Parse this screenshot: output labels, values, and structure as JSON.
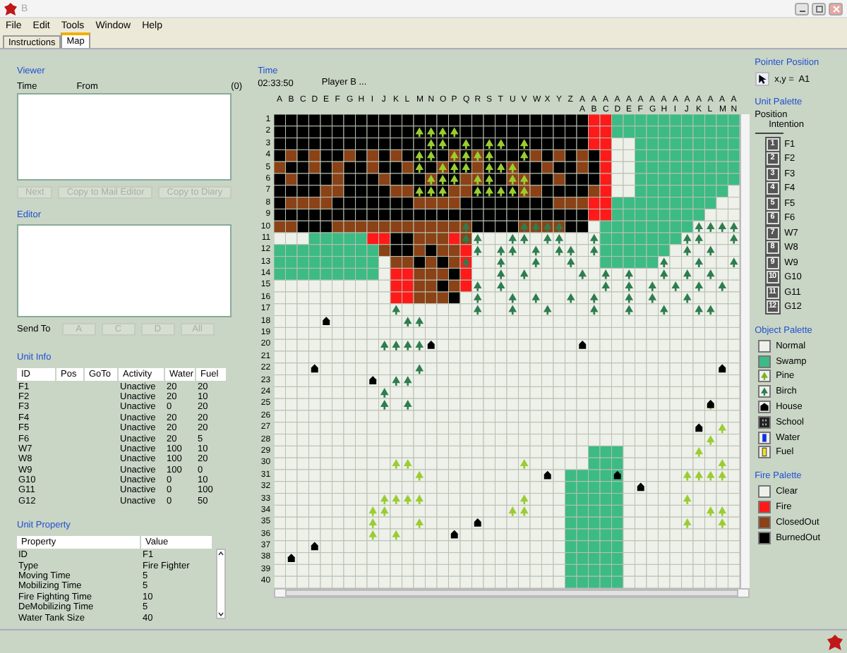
{
  "window": {
    "title": "B"
  },
  "menu": [
    "File",
    "Edit",
    "Tools",
    "Window",
    "Help"
  ],
  "tabs": [
    {
      "label": "Instructions",
      "selected": false
    },
    {
      "label": "Map",
      "selected": true
    }
  ],
  "viewer": {
    "title": "Viewer",
    "columns": [
      "Time",
      "From"
    ],
    "count": "(0)",
    "buttons": [
      {
        "label": "Next",
        "disabled": true
      },
      {
        "label": "Copy to Mail Editor",
        "disabled": true
      },
      {
        "label": "Copy to Diary",
        "disabled": true
      }
    ]
  },
  "editor": {
    "title": "Editor",
    "send_to_label": "Send To",
    "buttons": [
      {
        "label": "A",
        "disabled": true
      },
      {
        "label": "C",
        "disabled": true
      },
      {
        "label": "D",
        "disabled": true
      },
      {
        "label": "All",
        "disabled": true
      }
    ]
  },
  "unit_info": {
    "title": "Unit Info",
    "columns": [
      "ID",
      "Pos",
      "GoTo",
      "Activity",
      "Water",
      "Fuel"
    ],
    "rows": [
      {
        "id": "F1",
        "activity": "Unactive",
        "water": "20",
        "fuel": "20"
      },
      {
        "id": "F2",
        "activity": "Unactive",
        "water": "20",
        "fuel": "10"
      },
      {
        "id": "F3",
        "activity": "Unactive",
        "water": "0",
        "fuel": "20"
      },
      {
        "id": "F4",
        "activity": "Unactive",
        "water": "20",
        "fuel": "20"
      },
      {
        "id": "F5",
        "activity": "Unactive",
        "water": "20",
        "fuel": "20"
      },
      {
        "id": "F6",
        "activity": "Unactive",
        "water": "20",
        "fuel": "5"
      },
      {
        "id": "W7",
        "activity": "Unactive",
        "water": "100",
        "fuel": "10"
      },
      {
        "id": "W8",
        "activity": "Unactive",
        "water": "100",
        "fuel": "20"
      },
      {
        "id": "W9",
        "activity": "Unactive",
        "water": "100",
        "fuel": "0"
      },
      {
        "id": "G10",
        "activity": "Unactive",
        "water": "0",
        "fuel": "10"
      },
      {
        "id": "G11",
        "activity": "Unactive",
        "water": "0",
        "fuel": "100"
      },
      {
        "id": "G12",
        "activity": "Unactive",
        "water": "0",
        "fuel": "50"
      }
    ]
  },
  "unit_property": {
    "title": "Unit Property",
    "columns": [
      "Property",
      "Value"
    ],
    "rows": [
      {
        "property": "ID",
        "value": "F1"
      },
      {
        "property": "Type",
        "value": "Fire Fighter"
      },
      {
        "property": "Moving Time",
        "value": "5"
      },
      {
        "property": "Mobilizing Time",
        "value": "5"
      },
      {
        "property": "Fire Fighting Time",
        "value": "10"
      },
      {
        "property": "DeMobilizing Time",
        "value": "5"
      },
      {
        "property": "Water Tank Size",
        "value": "40"
      }
    ]
  },
  "map": {
    "time_label": "Time",
    "time": "02:33:50",
    "player": "Player B ...",
    "columns": [
      "A",
      "B",
      "C",
      "D",
      "E",
      "F",
      "G",
      "H",
      "I",
      "J",
      "K",
      "L",
      "M",
      "N",
      "O",
      "P",
      "Q",
      "R",
      "S",
      "T",
      "U",
      "V",
      "W",
      "X",
      "Y",
      "Z",
      "AA",
      "AB",
      "AC",
      "AD",
      "AE",
      "AF",
      "AG",
      "AH",
      "AI",
      "AJ",
      "AK",
      "AL",
      "AM",
      "AN"
    ],
    "rows": [
      "1",
      "2",
      "3",
      "4",
      "5",
      "6",
      "7",
      "8",
      "9",
      "10",
      "11",
      "12",
      "13",
      "14",
      "15",
      "16",
      "17",
      "18",
      "19",
      "20",
      "21",
      "22",
      "23",
      "24",
      "25",
      "26",
      "27",
      "28",
      "29",
      "30",
      "31",
      "32",
      "33",
      "34",
      "35",
      "36",
      "37",
      "38",
      "39",
      "40"
    ]
  },
  "pointer_position": {
    "title": "Pointer Position",
    "reading": "x,y =  A1"
  },
  "unit_palette": {
    "title": "Unit Palette",
    "position_label": "Position",
    "intention_label": "Intention",
    "units": [
      {
        "badge": "1",
        "name": "F1"
      },
      {
        "badge": "2",
        "name": "F2"
      },
      {
        "badge": "3",
        "name": "F3"
      },
      {
        "badge": "4",
        "name": "F4"
      },
      {
        "badge": "5",
        "name": "F5"
      },
      {
        "badge": "6",
        "name": "F6"
      },
      {
        "badge": "7",
        "name": "W7"
      },
      {
        "badge": "8",
        "name": "W8"
      },
      {
        "badge": "9",
        "name": "W9"
      },
      {
        "badge": "10",
        "name": "G10"
      },
      {
        "badge": "11",
        "name": "G11"
      },
      {
        "badge": "12",
        "name": "G12"
      }
    ]
  },
  "object_palette": {
    "title": "Object Palette",
    "items": [
      {
        "kind": "normal",
        "label": "Normal"
      },
      {
        "kind": "swamp",
        "label": "Swamp"
      },
      {
        "kind": "pine",
        "label": "Pine"
      },
      {
        "kind": "birch",
        "label": "Birch"
      },
      {
        "kind": "house",
        "label": "House"
      },
      {
        "kind": "school",
        "label": "School"
      },
      {
        "kind": "water",
        "label": "Water"
      },
      {
        "kind": "fuel",
        "label": "Fuel"
      }
    ]
  },
  "fire_palette": {
    "title": "Fire Palette",
    "items": [
      {
        "kind": "clear",
        "label": "Clear"
      },
      {
        "kind": "fire",
        "label": "Fire"
      },
      {
        "kind": "closedout",
        "label": "ClosedOut"
      },
      {
        "kind": "burnedout",
        "label": "BurnedOut"
      }
    ]
  }
}
